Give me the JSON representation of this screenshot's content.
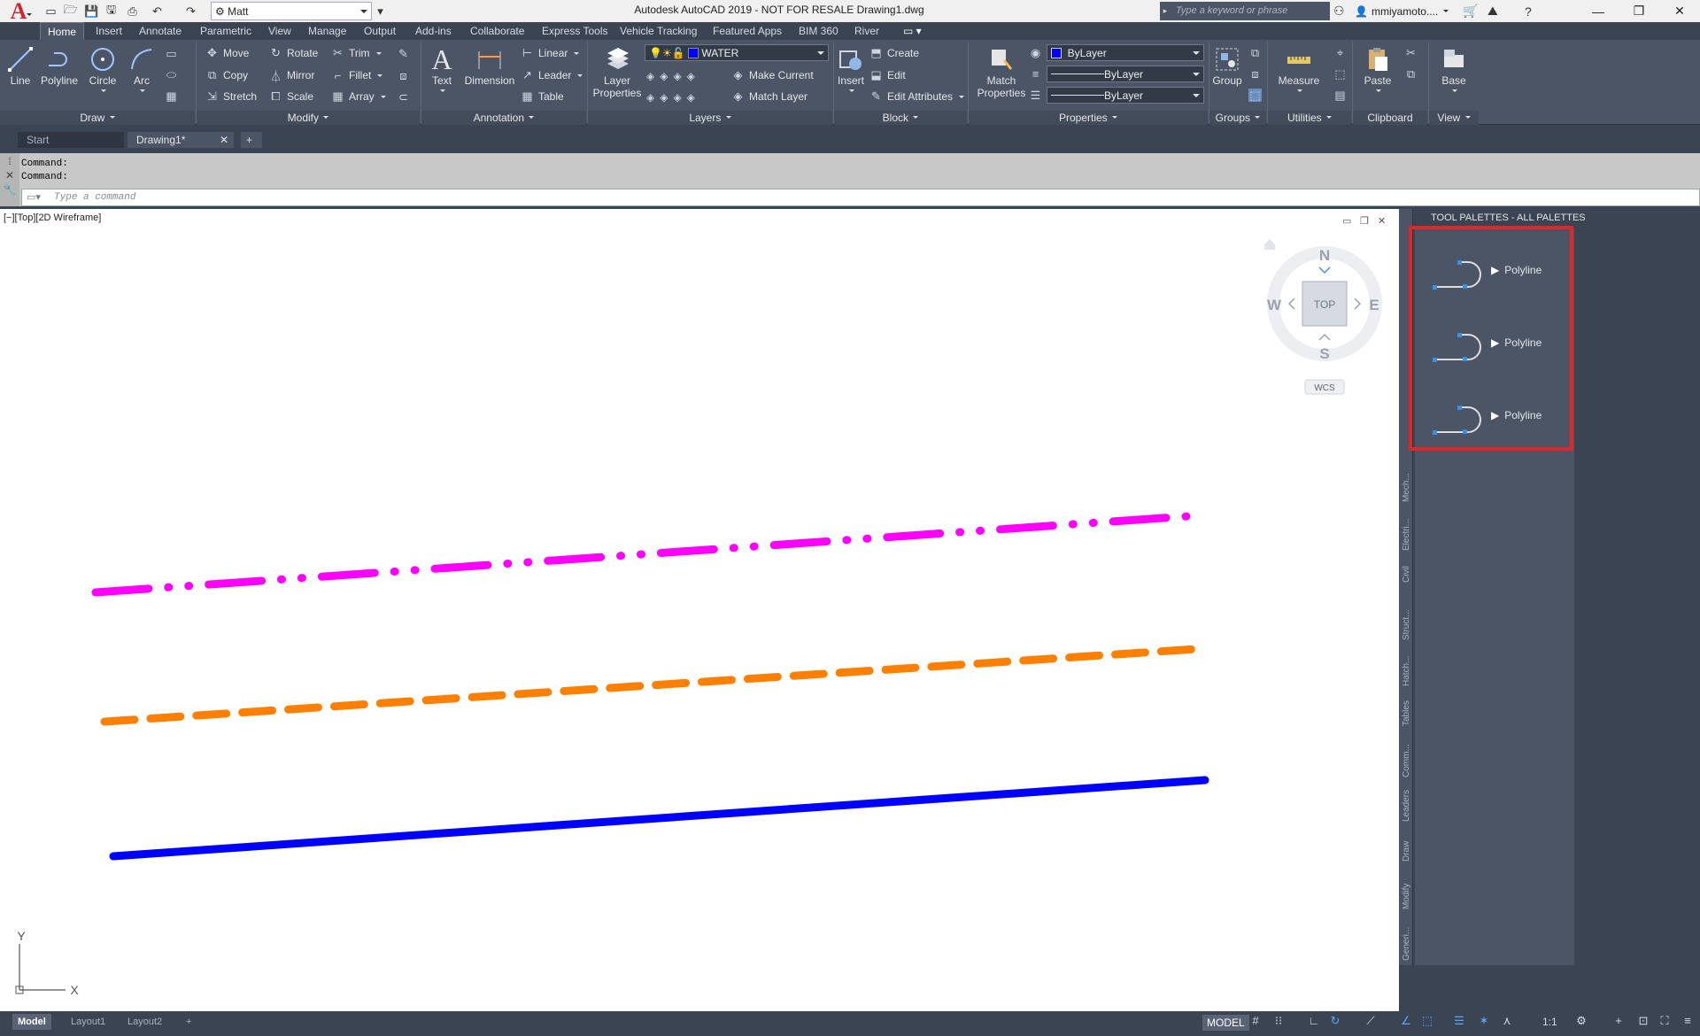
{
  "app": {
    "window_title": "Autodesk AutoCAD 2019 - NOT FOR RESALE   Drawing1.dwg",
    "workspace": "Matt",
    "search_placeholder": "Type a keyword or phrase",
    "user": "mmiyamoto....",
    "accent": "#d2232a"
  },
  "ribbon_tabs": [
    "Home",
    "Insert",
    "Annotate",
    "Parametric",
    "View",
    "Manage",
    "Output",
    "Add-ins",
    "Collaborate",
    "Express Tools",
    "Vehicle Tracking",
    "Featured Apps",
    "BIM 360",
    "River"
  ],
  "draw": {
    "title": "Draw",
    "line": "Line",
    "polyline": "Polyline",
    "circle": "Circle",
    "arc": "Arc"
  },
  "modify": {
    "title": "Modify",
    "move": "Move",
    "rotate": "Rotate",
    "trim": "Trim",
    "copy": "Copy",
    "mirror": "Mirror",
    "fillet": "Fillet",
    "stretch": "Stretch",
    "scale": "Scale",
    "array": "Array"
  },
  "annotation": {
    "title": "Annotation",
    "text": "Text",
    "dimension": "Dimension",
    "linear": "Linear",
    "leader": "Leader",
    "table": "Table"
  },
  "layers": {
    "title": "Layers",
    "layer_properties": "Layer Properties",
    "current_layer": "WATER",
    "layer_color": "#0000ff",
    "make_current": "Make Current",
    "match_layer": "Match Layer"
  },
  "block": {
    "title": "Block",
    "insert": "Insert",
    "create": "Create",
    "edit": "Edit",
    "edit_attributes": "Edit Attributes"
  },
  "properties": {
    "title": "Properties",
    "match_properties": "Match Properties",
    "color": "ByLayer",
    "linetype": "ByLayer",
    "lineweight": "ByLayer"
  },
  "groups": {
    "title": "Groups",
    "group": "Group"
  },
  "utilities": {
    "title": "Utilities",
    "measure": "Measure"
  },
  "clipboard": {
    "title": "Clipboard",
    "paste": "Paste"
  },
  "view": {
    "title": "View",
    "base": "Base"
  },
  "doc_tabs": {
    "start": "Start",
    "drawing": "Drawing1*"
  },
  "command": {
    "line1": "Command:",
    "line2": "Command:",
    "placeholder": "Type a command"
  },
  "viewport": {
    "label": "[−][Top][2D Wireframe]",
    "cube_face": "TOP",
    "north": "N",
    "south": "S",
    "east": "E",
    "west": "W",
    "ucs": "WCS",
    "axis_x": "X",
    "axis_y": "Y"
  },
  "drawing_lines": [
    {
      "color": "#ff00ff",
      "style": "dash-dot-dot"
    },
    {
      "color": "#ff8000",
      "style": "dashed"
    },
    {
      "color": "#0000ff",
      "style": "continuous"
    }
  ],
  "tool_palette": {
    "title": "TOOL PALETTES - ALL PALETTES",
    "items": [
      {
        "label": "Polyline"
      },
      {
        "label": "Polyline"
      },
      {
        "label": "Polyline"
      }
    ],
    "side_tabs": [
      "Mech...",
      "Electri...",
      "Civil",
      "Struct...",
      "Hatch...",
      "Tables",
      "Comm...",
      "Leaders",
      "Draw",
      "Modify",
      "Generi..."
    ],
    "highlight_color": "#e0252b"
  },
  "layout_tabs": [
    "Model",
    "Layout1",
    "Layout2"
  ],
  "status": {
    "model": "MODEL",
    "scale": "1:1"
  }
}
